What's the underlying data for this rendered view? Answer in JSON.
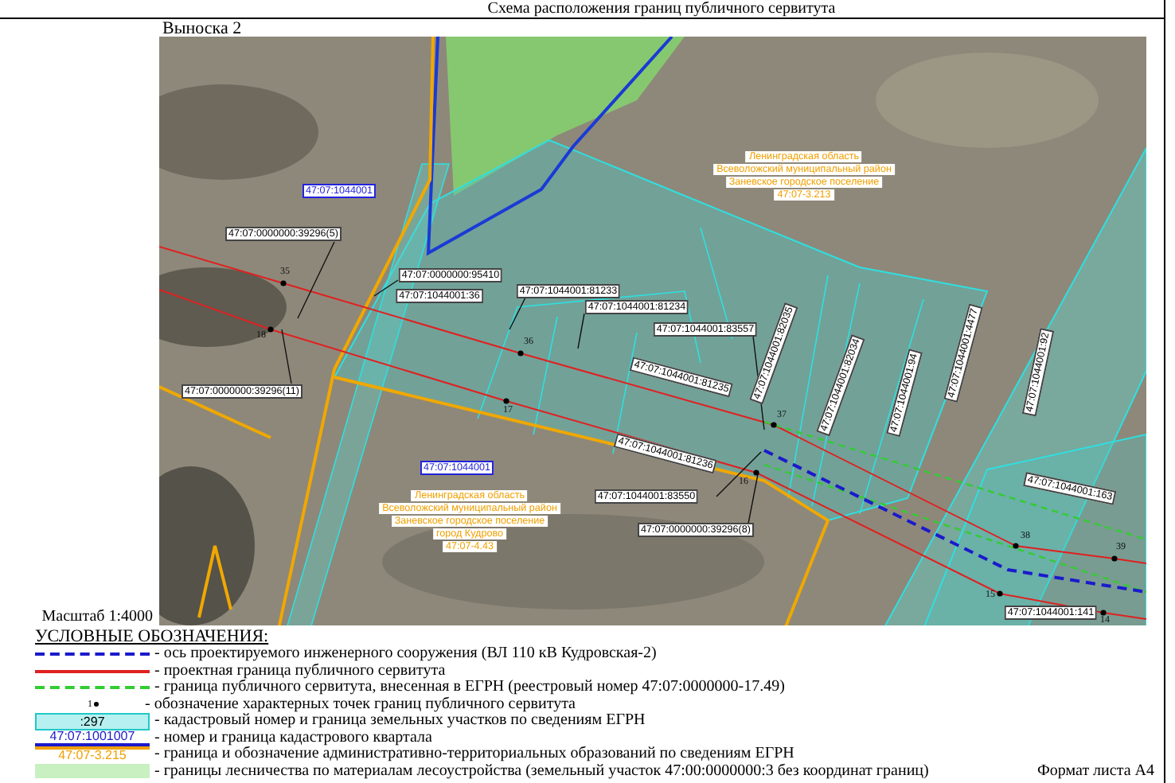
{
  "header": {
    "title": "Схема расположения границ публичного сервитута"
  },
  "inset": {
    "title": "Выноска 2"
  },
  "map": {
    "labels": [
      {
        "text": "47:07:1044001",
        "kind": "quarter"
      },
      {
        "text": "47:07:0000000:39296(5)",
        "kind": "parcel"
      },
      {
        "text": "47:07:0000000:95410",
        "kind": "parcel"
      },
      {
        "text": "47:07:1044001:36",
        "kind": "parcel"
      },
      {
        "text": "47:07:1044001:81233",
        "kind": "parcel"
      },
      {
        "text": "47:07:1044001:81234",
        "kind": "parcel"
      },
      {
        "text": "47:07:1044001:83557",
        "kind": "parcel"
      },
      {
        "text": "47:07:1044001:81235",
        "kind": "parcel"
      },
      {
        "text": "47:07:0000000:39296(11)",
        "kind": "parcel"
      },
      {
        "text": "47:07:1044001:82035",
        "kind": "parcel"
      },
      {
        "text": "47:07:1044001:82034",
        "kind": "parcel"
      },
      {
        "text": "47:07:1044001:94",
        "kind": "parcel"
      },
      {
        "text": "47:07:1044001:4477",
        "kind": "parcel"
      },
      {
        "text": "47:07:1044001:92",
        "kind": "parcel"
      },
      {
        "text": "47:07:1044001:81236",
        "kind": "parcel"
      },
      {
        "text": "47:07:1044001",
        "kind": "quarter"
      },
      {
        "text": "47:07:1044001:83550",
        "kind": "parcel"
      },
      {
        "text": "47:07:0000000:39296(8)",
        "kind": "parcel"
      },
      {
        "text": "47:07:1044001:163",
        "kind": "parcel"
      },
      {
        "text": "47:07:1044001:141",
        "kind": "parcel"
      }
    ],
    "admin_areas": [
      {
        "lines": [
          "Ленинградская область",
          "Всеволожский муниципальный район",
          "Заневское городское поселение",
          "47:07-3.213"
        ]
      },
      {
        "lines": [
          "Ленинградская область",
          "Всеволожский муниципальный район",
          "Заневское городское поселение",
          "город Кудрово",
          "47:07-4.43"
        ]
      }
    ],
    "points": [
      {
        "number": "35"
      },
      {
        "number": "18"
      },
      {
        "number": "36"
      },
      {
        "number": "17"
      },
      {
        "number": "37"
      },
      {
        "number": "16"
      },
      {
        "number": "38"
      },
      {
        "number": "39"
      },
      {
        "number": "15"
      },
      {
        "number": "14"
      }
    ]
  },
  "scale": "Масштаб 1:4000",
  "legend": {
    "title": "УСЛОВНЫЕ ОБОЗНАЧЕНИЯ:",
    "items": [
      {
        "kind": "axis",
        "text": "- ось проектируемого инженерного сооружения (ВЛ 110 кВ Кудровская-2)"
      },
      {
        "kind": "project-boundary",
        "text": "- проектная граница публичного сервитута"
      },
      {
        "kind": "registered-boundary",
        "text": "- граница публичного сервитута, внесенная в ЕГРН (реестровый номер  47:07:0000000-17.49)"
      },
      {
        "kind": "point",
        "symbol_text": "1",
        "text": "- обозначение характерных точек границ публичного сервитута"
      },
      {
        "kind": "parcel",
        "symbol_text": ":297",
        "text": "- кадастровый номер и граница земельных участков по сведениям ЕГРН"
      },
      {
        "kind": "quarter",
        "symbol_text": "47:07:1001007",
        "text": "- номер и граница кадастрового квартала"
      },
      {
        "kind": "admin",
        "symbol_text": "47:07-3.215",
        "text": "- граница и обозначение административно-территориальных образований по сведениям ЕГРН"
      },
      {
        "kind": "forestry",
        "text": "- границы лесничества по материалам лесоустройства (земельный участок 47:00:0000000:3 без координат границ)"
      }
    ]
  },
  "sheet_format": "Формат листа А4"
}
